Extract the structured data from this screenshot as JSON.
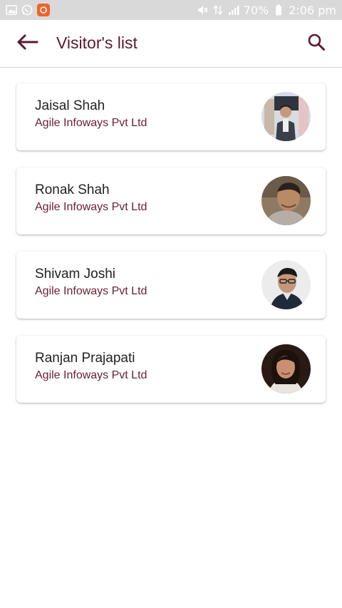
{
  "status_bar": {
    "battery_text": "70%",
    "time": "2:06 pm"
  },
  "header": {
    "title": "Visitor's list",
    "back_icon": "arrow-left-icon",
    "search_icon": "search-icon"
  },
  "colors": {
    "accent": "#5a1a2f",
    "company_text": "#6a2035"
  },
  "visitors": [
    {
      "name": "Jaisal Shah",
      "company": "Agile Infoways Pvt Ltd"
    },
    {
      "name": "Ronak Shah",
      "company": "Agile Infoways Pvt Ltd"
    },
    {
      "name": "Shivam Joshi",
      "company": "Agile Infoways Pvt Ltd"
    },
    {
      "name": "Ranjan Prajapati",
      "company": "Agile Infoways Pvt Ltd"
    }
  ]
}
